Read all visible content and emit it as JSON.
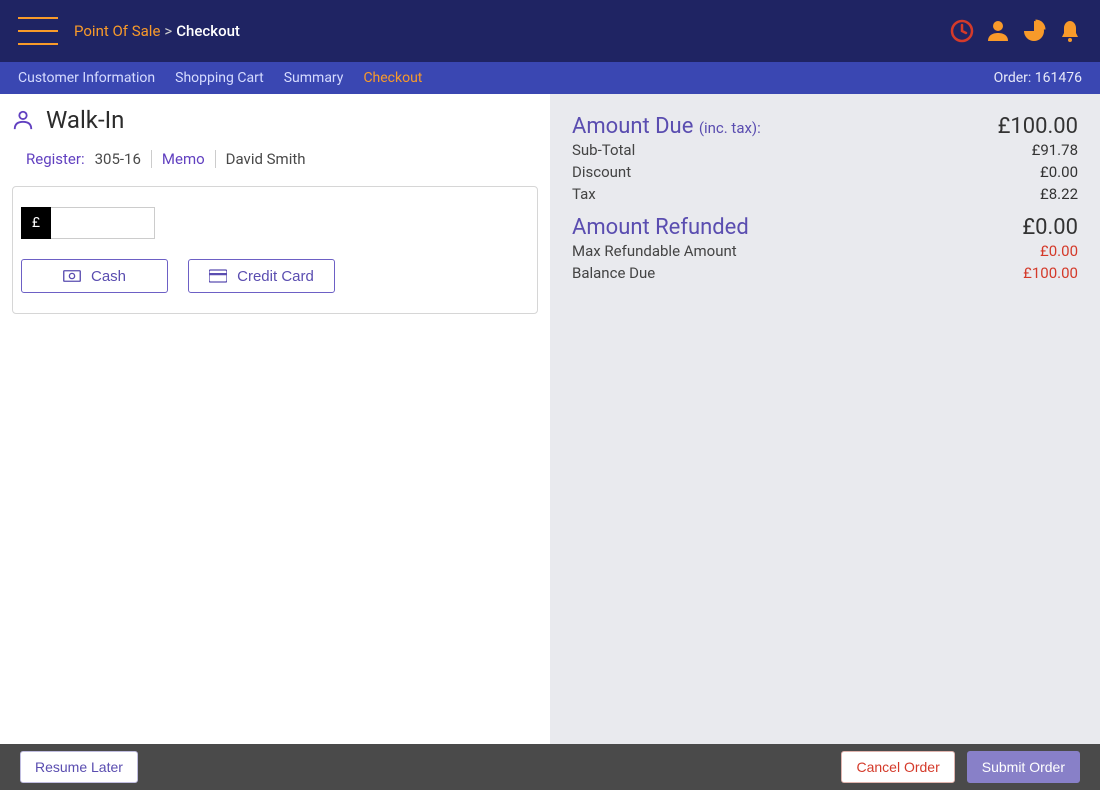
{
  "header": {
    "breadcrumb_root": "Point Of Sale",
    "breadcrumb_sep": ">",
    "breadcrumb_current": "Checkout"
  },
  "subnav": {
    "items": [
      {
        "label": "Customer Information",
        "active": false
      },
      {
        "label": "Shopping Cart",
        "active": false
      },
      {
        "label": "Summary",
        "active": false
      },
      {
        "label": "Checkout",
        "active": true
      }
    ],
    "order_label": "Order:",
    "order_number": "161476"
  },
  "customer": {
    "name": "Walk-In",
    "register_label": "Register:",
    "register_value": "305-16",
    "memo_label": "Memo",
    "clerk_name": "David Smith"
  },
  "payment": {
    "currency_symbol": "£",
    "amount_value": "",
    "cash_label": "Cash",
    "credit_label": "Credit Card"
  },
  "summary": {
    "amount_due_label": "Amount Due",
    "amount_due_sub": "(inc. tax):",
    "amount_due_value": "£100.00",
    "subtotal_label": "Sub-Total",
    "subtotal_value": "£91.78",
    "discount_label": "Discount",
    "discount_value": "£0.00",
    "tax_label": "Tax",
    "tax_value": "£8.22",
    "refunded_label": "Amount Refunded",
    "refunded_value": "£0.00",
    "max_refund_label": "Max Refundable Amount",
    "max_refund_value": "£0.00",
    "balance_label": "Balance Due",
    "balance_value": "£100.00"
  },
  "footer": {
    "resume_label": "Resume Later",
    "cancel_label": "Cancel Order",
    "submit_label": "Submit Order"
  },
  "icons": {
    "clock": "clock-icon",
    "user": "user-icon",
    "chart": "chart-icon",
    "bell": "bell-icon"
  }
}
